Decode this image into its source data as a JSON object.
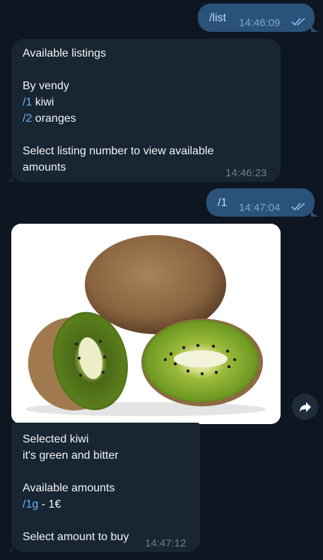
{
  "messages": {
    "m1": {
      "text": "/list",
      "time": "14:46:09"
    },
    "m2": {
      "title": "Available listings",
      "by": "By vendy",
      "item1_cmd": "/1",
      "item1_name": " kiwi",
      "item2_cmd": "/2",
      "item2_name": " oranges",
      "prompt1": "Select listing number to view available",
      "prompt2": "amounts",
      "time": "14:46:23"
    },
    "m3": {
      "text": "/1",
      "time": "14:47:04"
    },
    "m4": {
      "line1": "Selected kiwi",
      "line2": "it's green and bitter",
      "line3": "Available amounts",
      "amount_cmd": "/1g",
      "amount_price": " - 1€",
      "line5": "Select amount to buy",
      "time": "14:47:12"
    }
  },
  "colors": {
    "background": "#0e1621",
    "outgoing_bubble": "#2b5278",
    "incoming_bubble": "#182533",
    "link": "#6ab2f2"
  },
  "icons": {
    "read_status": "double-check-icon",
    "forward": "forward-arrow-icon"
  }
}
